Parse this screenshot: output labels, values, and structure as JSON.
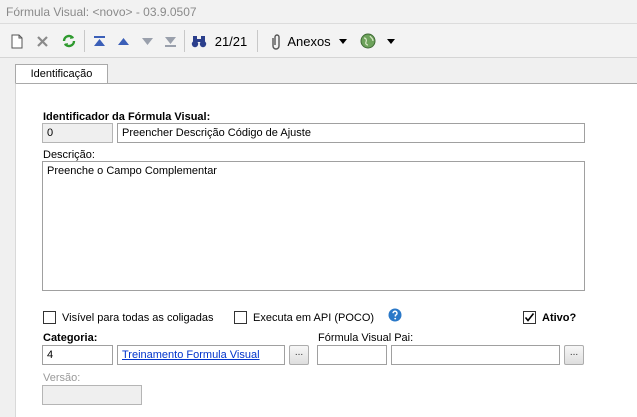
{
  "window": {
    "title": "Fórmula Visual: <novo> - 03.9.0507"
  },
  "toolbar": {
    "record_counter": "21/21",
    "attachments_label": "Anexos"
  },
  "tabs": [
    {
      "label": "Identificação"
    }
  ],
  "form": {
    "identifier": {
      "label": "Identificador da Fórmula Visual:",
      "code": "0",
      "name": "Preencher Descrição Código de Ajuste"
    },
    "description": {
      "label": "Descrição:",
      "value": "Preenche o Campo Complementar"
    },
    "visible_all": {
      "label": "Visível para todas as coligadas",
      "checked": false
    },
    "execute_api": {
      "label": "Executa em API (POCO)",
      "checked": false
    },
    "active": {
      "label": "Ativo?",
      "checked": true
    },
    "category": {
      "label": "Categoria:",
      "code": "4",
      "name": "Treinamento Formula Visual",
      "lookup": "..."
    },
    "parent": {
      "label": "Fórmula Visual Pai:",
      "code": "",
      "name": "",
      "lookup": "..."
    },
    "version": {
      "label": "Versão:",
      "value": ""
    }
  },
  "colors": {
    "link": "#0033cc",
    "help": "#2a78c8",
    "refresh": "#2e9a2e",
    "nav": "#3b5fb8"
  }
}
